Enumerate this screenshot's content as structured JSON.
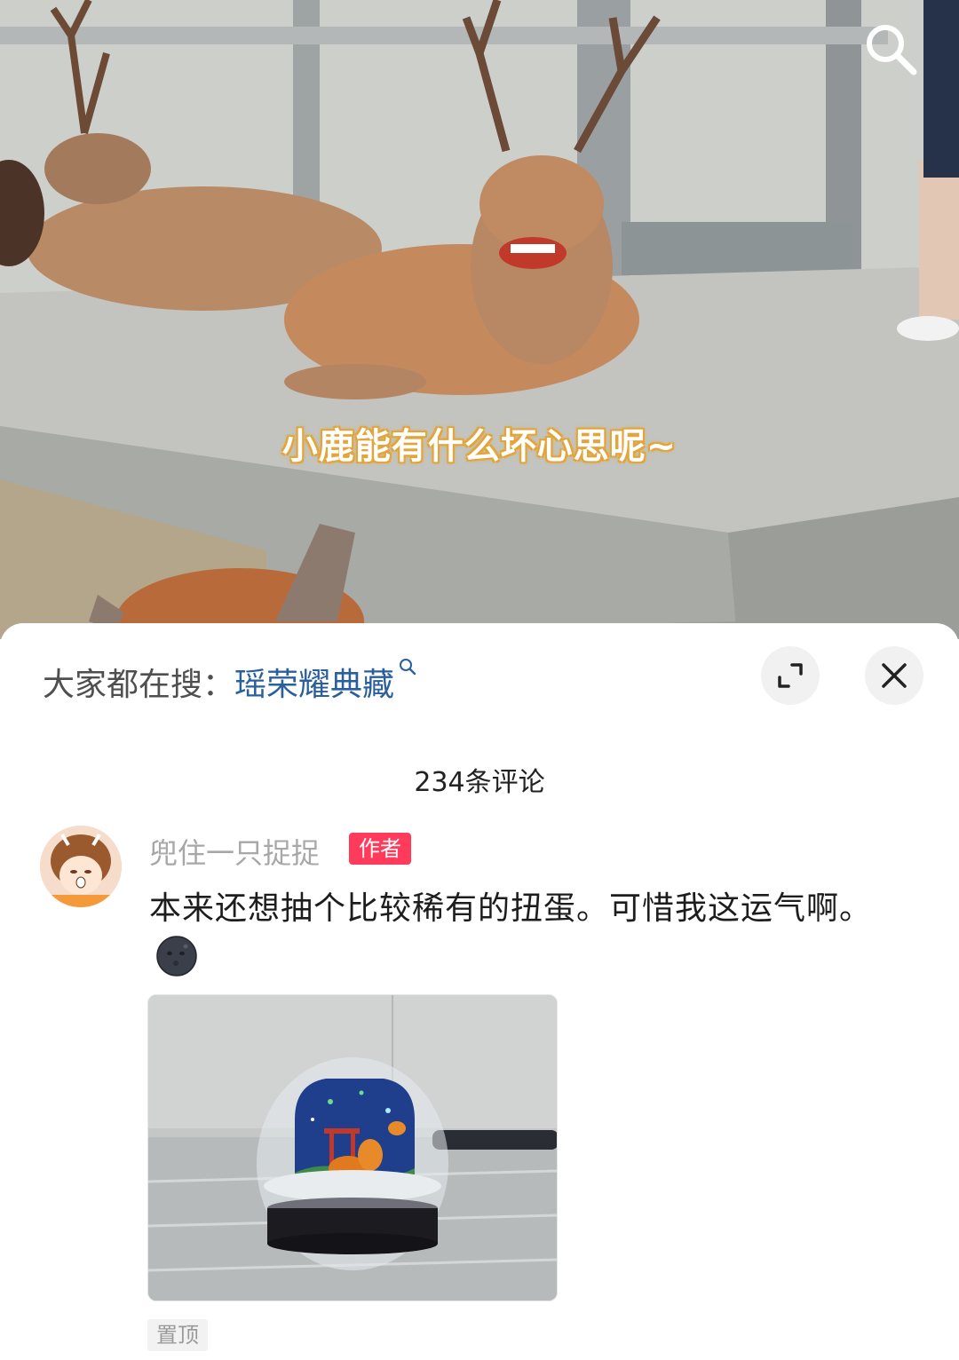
{
  "video": {
    "subtitle": "小鹿能有什么坏心思呢~",
    "search_icon": "search-icon"
  },
  "sheet": {
    "hot_search_prefix": "大家都在搜：",
    "hot_search_keyword": "瑶荣耀典藏",
    "expand_icon": "expand-icon",
    "close_icon": "close-icon"
  },
  "comments": {
    "count_label": "234条评论",
    "items": [
      {
        "username": "兜住一只捉捉",
        "tag": "作者",
        "text": "本来还想抽个比较稀有的扭蛋。可惜我这运气啊。",
        "emoji": "new-moon-face-emoji",
        "pinned_label": "置顶"
      }
    ]
  },
  "colors": {
    "keyword": "#2a5f9e",
    "author_tag": "#ff3b5c",
    "subtitle_outline": "#e3a53a"
  }
}
